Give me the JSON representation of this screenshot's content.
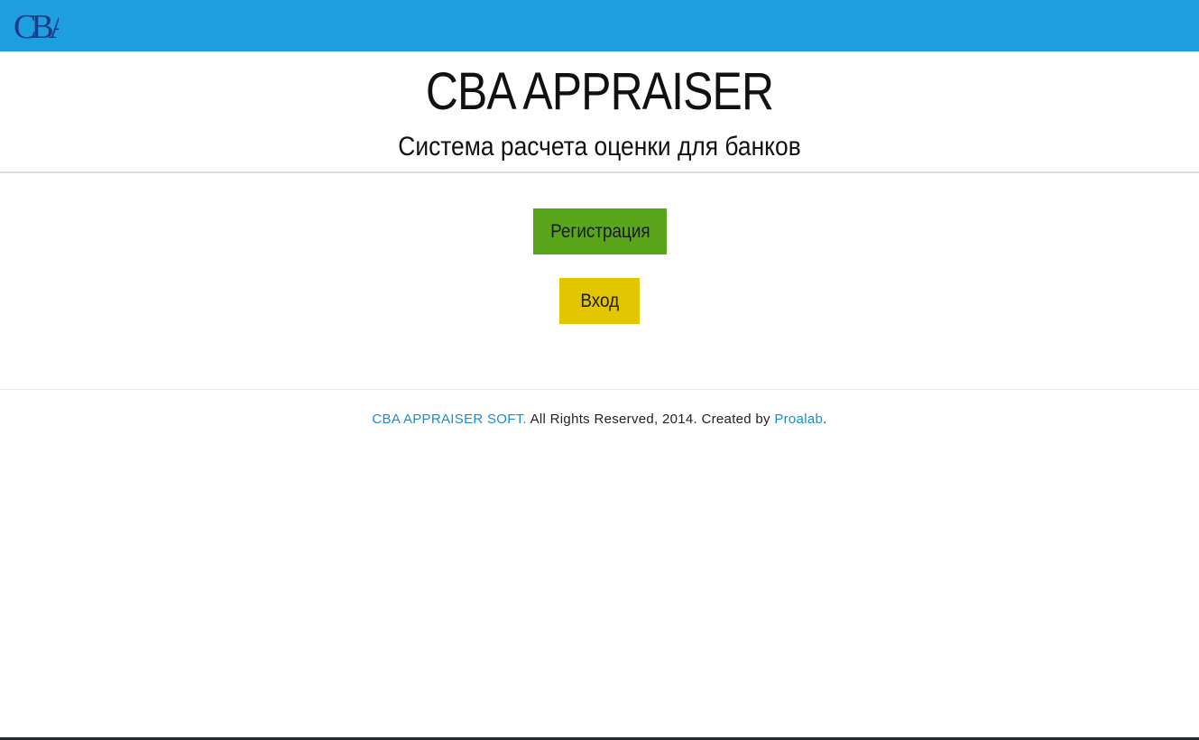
{
  "header": {
    "logo_text": "CBA",
    "bar_color": "#1ea0e0"
  },
  "hero": {
    "title": "CBA APPRAISER",
    "subtitle": "Система расчета оценки для банков"
  },
  "actions": {
    "register_label": "Регистрация",
    "login_label": "Вход",
    "register_color": "#5aa61a",
    "login_color": "#e2c700"
  },
  "footer": {
    "brand_link": "CBA APPRAISER SOFT.",
    "rights_text": " All Rights Reserved, 2014. Created by ",
    "creator_link": "Proalab",
    "end_punct": "."
  }
}
